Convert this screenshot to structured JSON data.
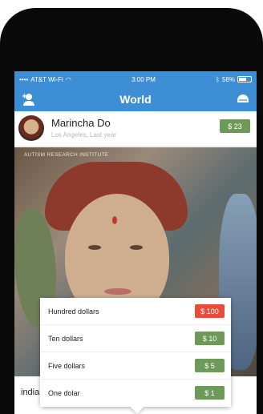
{
  "status_bar": {
    "carrier": "AT&T Wi-Fi",
    "time": "3:00 PM",
    "battery": "58%"
  },
  "navbar": {
    "title": "World",
    "left_icon": "add-user-icon",
    "right_icon": "inbox-icon",
    "page_count": 3,
    "active_page": 2
  },
  "post": {
    "author_name": "Marincha Do",
    "meta": "Los Angeles, Last year",
    "price": "$ 23",
    "photo_label": "AUTISM RESEARCH INSTITUTE",
    "caption": "india"
  },
  "donation_menu": {
    "options": [
      {
        "label": "Hundred dollars",
        "amount": "$ 100",
        "color": "#e74c3c"
      },
      {
        "label": "Ten dollars",
        "amount": "$ 10",
        "color": "#6e9a59"
      },
      {
        "label": "Five dollars",
        "amount": "$ 5",
        "color": "#6e9a59"
      },
      {
        "label": "One dolar",
        "amount": "$ 1",
        "color": "#6e9a59"
      }
    ]
  },
  "colors": {
    "primary": "#3e8ed6",
    "green": "#6e9a59",
    "red": "#e74c3c"
  }
}
